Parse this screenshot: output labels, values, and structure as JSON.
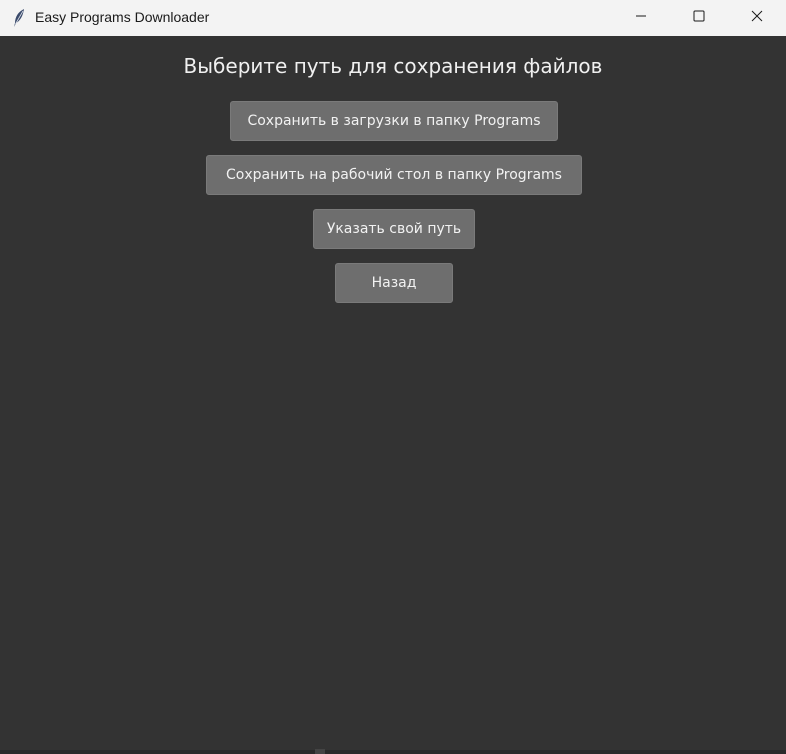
{
  "window": {
    "title": "Easy Programs Downloader",
    "icon": "feather-icon",
    "controls": [
      "minimize-icon",
      "maximize-icon",
      "close-icon"
    ]
  },
  "main": {
    "heading": "Выберите путь для сохранения файлов",
    "buttons": [
      {
        "label": "Сохранить в загрузки в папку Programs"
      },
      {
        "label": "Сохранить на рабочий стол в папку Programs"
      },
      {
        "label": "Указать свой путь"
      },
      {
        "label": "Назад"
      }
    ]
  },
  "colors": {
    "background": "#333333",
    "button": "#6e6e6e",
    "text": "#f0f0f0",
    "titlebar": "#f3f3f3"
  }
}
